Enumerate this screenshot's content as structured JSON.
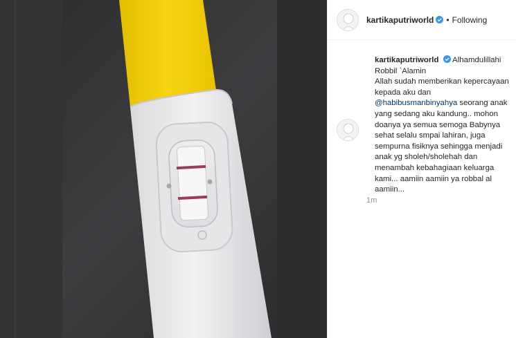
{
  "header": {
    "username": "kartikaputriworld",
    "separator": "•",
    "follow_label": "Following"
  },
  "caption": {
    "username": "kartikaputriworld",
    "line1": "Alhamdulillahi",
    "line2": "Robbil `Alamin",
    "line3": "Allah sudah memberikan kepercayaan",
    "line4": "kepada aku dan",
    "mention": "@habibusmanbinyahya",
    "after_mention": " seorang anak",
    "line6": "yang sedang aku kandung.. mohon",
    "line7": "doanya ya semua semoga Babynya",
    "line8": "sehat selalu smpai lahiran, juga",
    "line9": "sempurna fisiknya sehingga menjadi",
    "line10": "anak yg sholeh/sholehah dan",
    "line11": "menambah kebahagiaan keluarga",
    "line12": "kami... aamiin aamiin ya robbal al",
    "line13": "aamiin...",
    "timestamp": "1m"
  },
  "colors": {
    "mention": "#00376b",
    "verified": "#3897f0",
    "test_yellow": "#f4d00c",
    "test_line": "#9e3a5a"
  }
}
